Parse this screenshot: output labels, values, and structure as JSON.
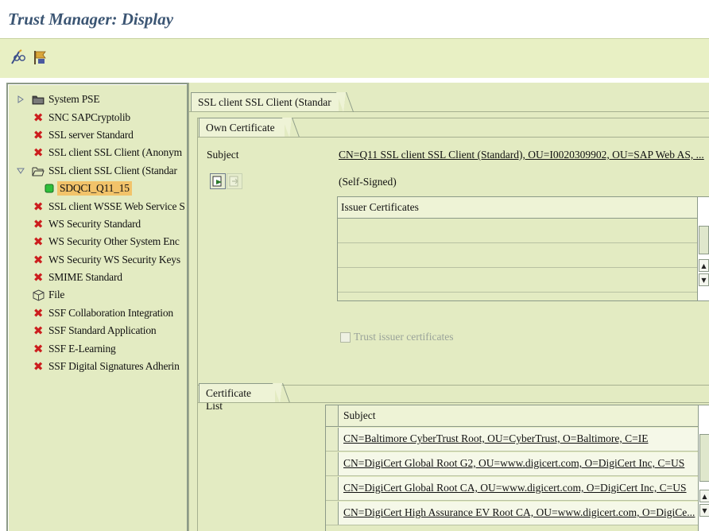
{
  "title": "Trust Manager: Display",
  "tree": {
    "items": [
      {
        "label": "System PSE",
        "icon": "folder-closed-icon",
        "level": 0,
        "expander": "collapsed"
      },
      {
        "label": "SNC SAPCryptolib",
        "icon": "red-x-icon",
        "level": 0
      },
      {
        "label": "SSL server Standard",
        "icon": "red-x-icon",
        "level": 0
      },
      {
        "label": "SSL client SSL Client (Anonym",
        "icon": "red-x-icon",
        "level": 0
      },
      {
        "label": "SSL client SSL Client (Standar",
        "icon": "folder-open-icon",
        "level": 0,
        "expander": "expanded"
      },
      {
        "label": "SDQCI_Q11_15",
        "icon": "green-square-icon",
        "level": 1,
        "selected": true
      },
      {
        "label": "SSL client WSSE Web Service S",
        "icon": "red-x-icon",
        "level": 0
      },
      {
        "label": "WS Security Standard",
        "icon": "red-x-icon",
        "level": 0
      },
      {
        "label": "WS Security Other System Enc",
        "icon": "red-x-icon",
        "level": 0
      },
      {
        "label": "WS Security WS Security Keys",
        "icon": "red-x-icon",
        "level": 0
      },
      {
        "label": "SMIME Standard",
        "icon": "red-x-icon",
        "level": 0
      },
      {
        "label": "File",
        "icon": "cube-icon",
        "level": 0
      },
      {
        "label": "SSF Collaboration Integration",
        "icon": "red-x-icon",
        "level": 0
      },
      {
        "label": "SSF Standard Application",
        "icon": "red-x-icon",
        "level": 0
      },
      {
        "label": "SSF E-Learning",
        "icon": "red-x-icon",
        "level": 0
      },
      {
        "label": "SSF Digital Signatures Adherin",
        "icon": "red-x-icon",
        "level": 0
      }
    ]
  },
  "detail": {
    "tab": "SSL client SSL Client (Standar",
    "own_certificate": {
      "section_label": "Own Certificate",
      "subject_label": "Subject",
      "subject_value": "CN=Q11 SSL client SSL Client (Standard), OU=I0020309902, OU=SAP Web AS, ...",
      "signed_status": "(Self-Signed)",
      "issuer_header": "Issuer Certificates",
      "trust_checkbox_label": "Trust issuer certificates",
      "trust_checked": false
    },
    "certificate_list": {
      "section_label": "Certificate List",
      "header": "Subject",
      "rows": [
        "CN=Baltimore CyberTrust Root, OU=CyberTrust, O=Baltimore, C=IE",
        "CN=DigiCert Global Root G2, OU=www.digicert.com, O=DigiCert Inc, C=US",
        "CN=DigiCert Global Root CA, OU=www.digicert.com, O=DigiCert Inc, C=US",
        "CN=DigiCert High Assurance EV Root CA, OU=www.digicert.com, O=DigiCe..."
      ]
    }
  },
  "colors": {
    "panel_bg": "#e3ebc2",
    "toolbar_bg": "#e8f0c4",
    "selected_bg": "#f2c36a",
    "title_color": "#3b5573",
    "error_red": "#cc1e1e"
  }
}
